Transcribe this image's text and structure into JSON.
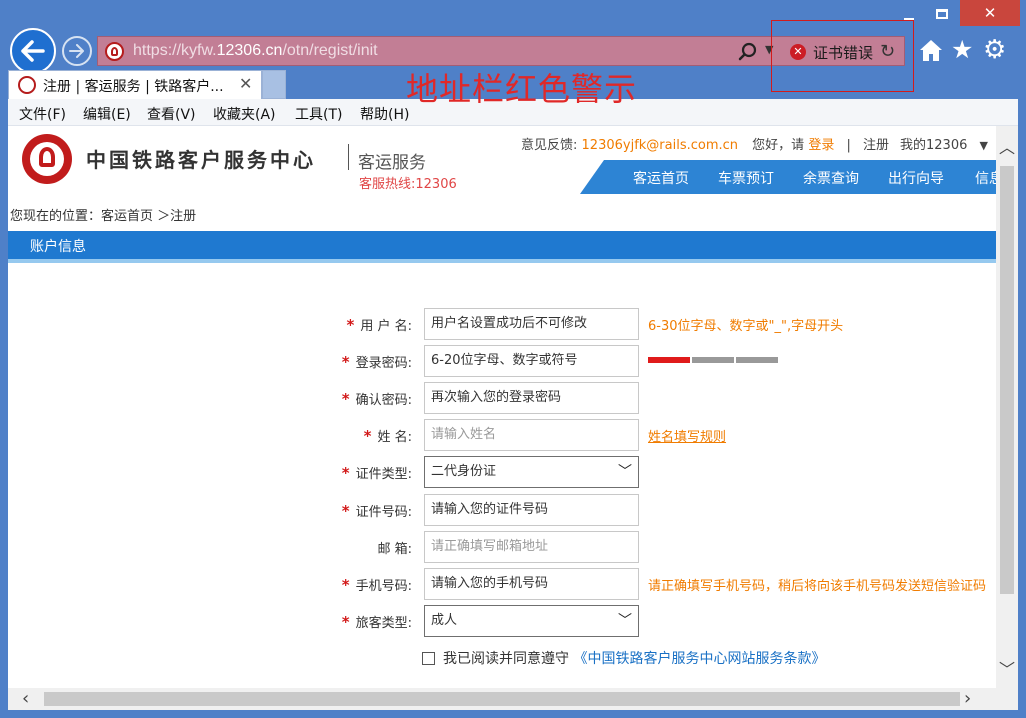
{
  "browser": {
    "address": {
      "url_prefix": "https://kyfw.",
      "url_domain": "12306.cn",
      "url_path": "/otn/regist/init",
      "cert_error": "证书错误"
    },
    "tab": {
      "title": "注册 | 客运服务 | 铁路客户...",
      "close": "✕"
    },
    "annotation": "地址栏红色警示",
    "menu": [
      "文件(F)",
      "编辑(E)",
      "查看(V)",
      "收藏夹(A)",
      "工具(T)",
      "帮助(H)"
    ],
    "address_color": "#c27e95",
    "chrome_color": "#4f80c8"
  },
  "site": {
    "logo_name": "中国铁路客户服务中心",
    "logo_sub": "客运服务",
    "hotline": "客服热线:12306",
    "feedback_label": "意见反馈:",
    "feedback_email": "12306yjfk@rails.com.cn",
    "greeting": "您好，请",
    "login": "登录",
    "register": "注册",
    "my_account": "我的12306",
    "nav": [
      "客运首页",
      "车票预订",
      "余票查询",
      "出行向导",
      "信息"
    ],
    "breadcrumb": "您现在的位置：客运首页 ＞注册",
    "section_title": "账户信息"
  },
  "form": {
    "fields": [
      {
        "label": "用 户 名:",
        "value": "用户名设置成功后不可修改",
        "hint": "6-30位字母、数字或\"_\",字母开头"
      },
      {
        "label": "登录密码:",
        "value": "6-20位字母、数字或符号"
      },
      {
        "label": "确认密码:",
        "value": "再次输入您的登录密码"
      },
      {
        "label": "姓 名:",
        "value": "请输入姓名",
        "link": "姓名填写规则"
      },
      {
        "label": "证件类型:",
        "value": "二代身份证"
      },
      {
        "label": "证件号码:",
        "value": "请输入您的证件号码"
      },
      {
        "label": "邮 箱:",
        "value": "请正确填写邮箱地址"
      },
      {
        "label": "手机号码:",
        "value": "请输入您的手机号码",
        "hint": "请正确填写手机号码，稍后将向该手机号码发送短信验证码"
      },
      {
        "label": "旅客类型:",
        "value": "成人"
      }
    ],
    "required_mark": "*",
    "password_strength": 1,
    "agree_text": "我已阅读并同意遵守",
    "terms_text": "《中国铁路客户服务中心网站服务条款》"
  }
}
